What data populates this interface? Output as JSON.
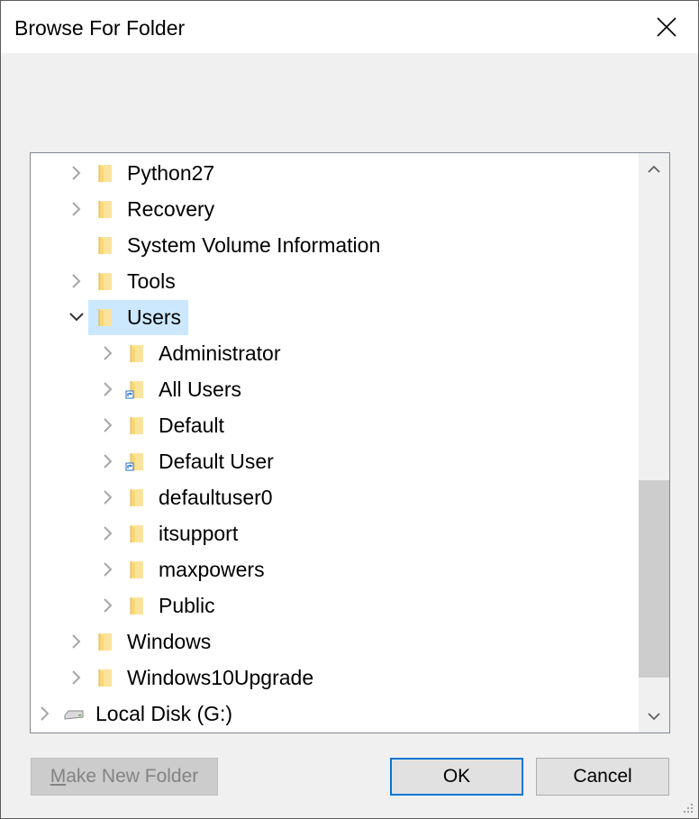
{
  "dialog": {
    "title": "Browse For Folder",
    "close_icon": "close-icon"
  },
  "tree": {
    "items": [
      {
        "label": "Python27",
        "level": 1,
        "expander": "collapsed",
        "icon": "folder-icon"
      },
      {
        "label": "Recovery",
        "level": 1,
        "expander": "collapsed",
        "icon": "folder-icon"
      },
      {
        "label": "System Volume Information",
        "level": 1,
        "expander": "none",
        "icon": "folder-icon"
      },
      {
        "label": "Tools",
        "level": 1,
        "expander": "collapsed",
        "icon": "folder-icon"
      },
      {
        "label": "Users",
        "level": 1,
        "expander": "expanded",
        "icon": "folder-icon",
        "selected": true
      },
      {
        "label": "Administrator",
        "level": 2,
        "expander": "collapsed",
        "icon": "folder-icon"
      },
      {
        "label": "All Users",
        "level": 2,
        "expander": "collapsed",
        "icon": "folder-shortcut-icon"
      },
      {
        "label": "Default",
        "level": 2,
        "expander": "collapsed",
        "icon": "folder-icon"
      },
      {
        "label": "Default User",
        "level": 2,
        "expander": "collapsed",
        "icon": "folder-shortcut-icon"
      },
      {
        "label": "defaultuser0",
        "level": 2,
        "expander": "collapsed",
        "icon": "folder-icon"
      },
      {
        "label": "itsupport",
        "level": 2,
        "expander": "collapsed",
        "icon": "folder-icon"
      },
      {
        "label": "maxpowers",
        "level": 2,
        "expander": "collapsed",
        "icon": "folder-icon"
      },
      {
        "label": "Public",
        "level": 2,
        "expander": "collapsed",
        "icon": "folder-icon"
      },
      {
        "label": "Windows",
        "level": 1,
        "expander": "collapsed",
        "icon": "folder-icon"
      },
      {
        "label": "Windows10Upgrade",
        "level": 1,
        "expander": "collapsed",
        "icon": "folder-icon"
      },
      {
        "label": "Local Disk (G:)",
        "level": 0,
        "expander": "collapsed",
        "icon": "drive-icon"
      }
    ],
    "scroll_position": 0.85
  },
  "buttons": {
    "make_new_folder": {
      "label_mnemonic": "M",
      "label_rest": "ake New Folder",
      "enabled": false
    },
    "ok": "OK",
    "cancel": "Cancel"
  },
  "colors": {
    "selection": "#cce8ff",
    "accent": "#0078d7",
    "folder": "#f8d775"
  }
}
